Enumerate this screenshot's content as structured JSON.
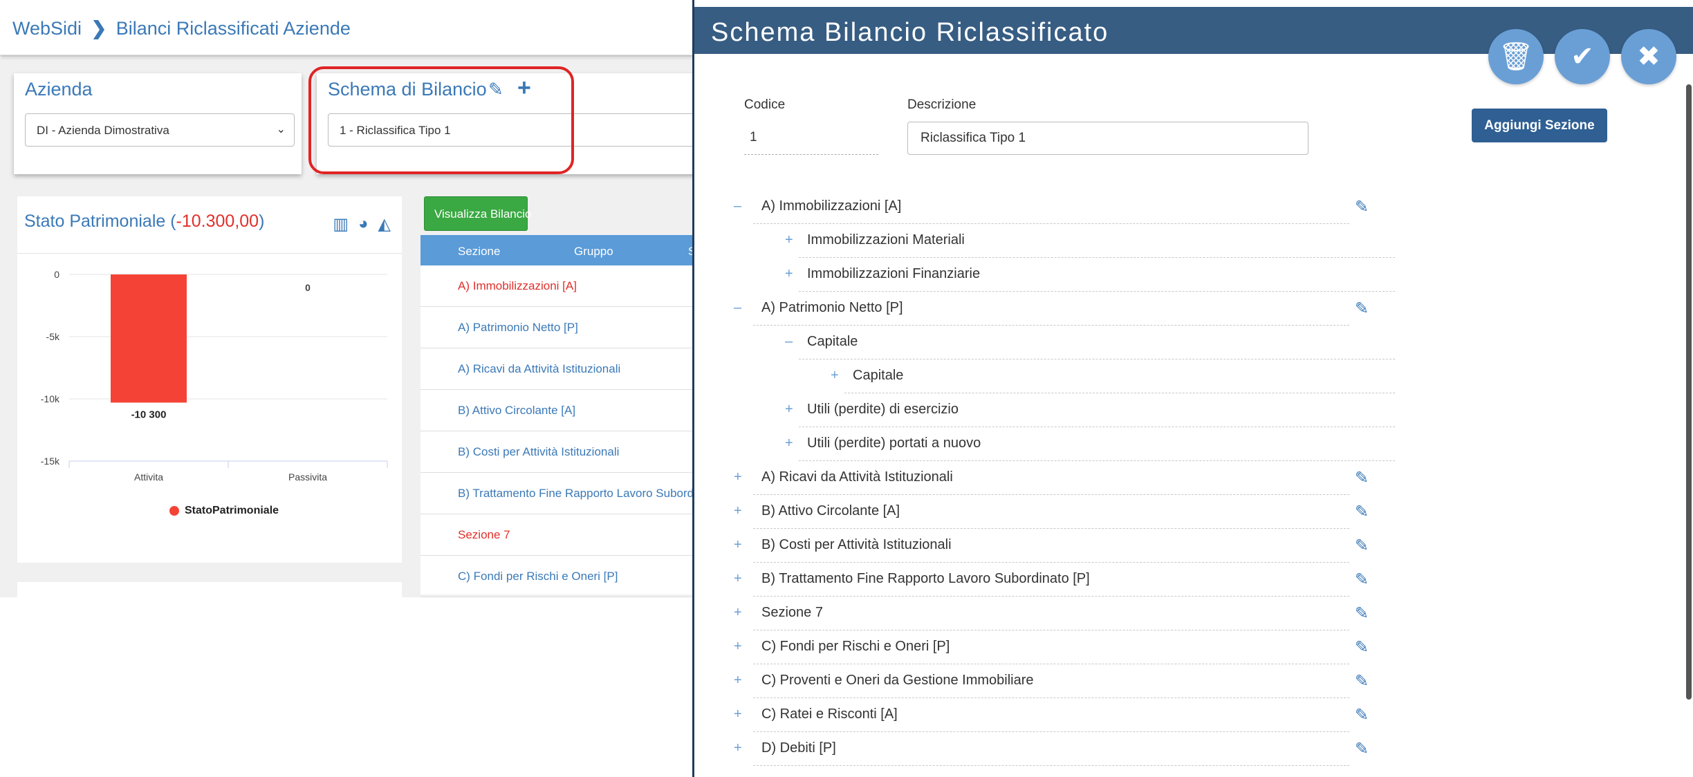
{
  "breadcrumb": {
    "home": "WebSidi",
    "separator": "❯",
    "current": "Bilanci Riclassificati Aziende"
  },
  "azienda": {
    "title": "Azienda",
    "selected": "DI - Azienda Dimostrativa"
  },
  "schema": {
    "title": "Schema di Bilancio",
    "selected": "1 - Riclassifica Tipo 1"
  },
  "stato": {
    "title_prefix": "Stato Patrimoniale (",
    "value": "-10.300,00",
    "title_suffix": ")"
  },
  "visualizza_label": "Visualizza Bilancio",
  "table": {
    "headers": [
      "Sezione",
      "Gruppo",
      "S"
    ],
    "rows": [
      {
        "label": "A) Immobilizzazioni [A]",
        "highlight": true
      },
      {
        "label": "A) Patrimonio Netto [P]",
        "highlight": false
      },
      {
        "label": "A) Ricavi da Attività Istituzionali",
        "highlight": false
      },
      {
        "label": "B) Attivo Circolante [A]",
        "highlight": false
      },
      {
        "label": "B) Costi per Attività Istituzionali",
        "highlight": false
      },
      {
        "label": "B) Trattamento Fine Rapporto Lavoro Subordinato [",
        "highlight": false
      },
      {
        "label": "Sezione 7",
        "highlight": true
      },
      {
        "label": "C) Fondi per Rischi e Oneri [P]",
        "highlight": false
      }
    ]
  },
  "chart_data": {
    "type": "bar",
    "categories": [
      "Attivita",
      "Passivita"
    ],
    "series": [
      {
        "name": "StatoPatrimoniale",
        "values": [
          -10300,
          0
        ],
        "color": "#f44336"
      }
    ],
    "data_labels": [
      "-10 300",
      "0"
    ],
    "y_ticks": [
      "0",
      "-5k",
      "-10k",
      "-15k"
    ],
    "ylim": [
      -15000,
      0
    ],
    "legend": "bottom-center",
    "grid": true
  },
  "modal": {
    "title": "Schema Bilancio Riclassificato",
    "buttons": {
      "delete": "trash-icon",
      "confirm": "check-icon",
      "close": "close-icon"
    },
    "codice_label": "Codice",
    "codice_value": "1",
    "descrizione_label": "Descrizione",
    "descrizione_value": "Riclassifica Tipo 1",
    "add_section_label": "Aggiungi Sezione",
    "tree": [
      {
        "level": 0,
        "toggle": "–",
        "label": "A) Immobilizzazioni [A]",
        "editable": true
      },
      {
        "level": 1,
        "toggle": "+",
        "label": "Immobilizzazioni Materiali",
        "editable": false
      },
      {
        "level": 1,
        "toggle": "+",
        "label": "Immobilizzazioni Finanziarie",
        "editable": false
      },
      {
        "level": 0,
        "toggle": "–",
        "label": "A) Patrimonio Netto [P]",
        "editable": true
      },
      {
        "level": 1,
        "toggle": "–",
        "label": "Capitale",
        "editable": false
      },
      {
        "level": 2,
        "toggle": "+",
        "label": "Capitale",
        "editable": false
      },
      {
        "level": 1,
        "toggle": "+",
        "label": "Utili (perdite) di esercizio",
        "editable": false
      },
      {
        "level": 1,
        "toggle": "+",
        "label": "Utili (perdite) portati a nuovo",
        "editable": false
      },
      {
        "level": 0,
        "toggle": "+",
        "label": "A) Ricavi da Attività Istituzionali",
        "editable": true
      },
      {
        "level": 0,
        "toggle": "+",
        "label": "B) Attivo Circolante [A]",
        "editable": true
      },
      {
        "level": 0,
        "toggle": "+",
        "label": "B) Costi per Attività Istituzionali",
        "editable": true
      },
      {
        "level": 0,
        "toggle": "+",
        "label": "B) Trattamento Fine Rapporto Lavoro Subordinato [P]",
        "editable": true
      },
      {
        "level": 0,
        "toggle": "+",
        "label": "Sezione 7",
        "editable": true
      },
      {
        "level": 0,
        "toggle": "+",
        "label": "C) Fondi per Rischi e Oneri [P]",
        "editable": true
      },
      {
        "level": 0,
        "toggle": "+",
        "label": "C) Proventi e Oneri da Gestione Immobiliare",
        "editable": true
      },
      {
        "level": 0,
        "toggle": "+",
        "label": "C) Ratei e Risconti [A]",
        "editable": true
      },
      {
        "level": 0,
        "toggle": "+",
        "label": "D) Debiti [P]",
        "editable": true
      }
    ]
  }
}
